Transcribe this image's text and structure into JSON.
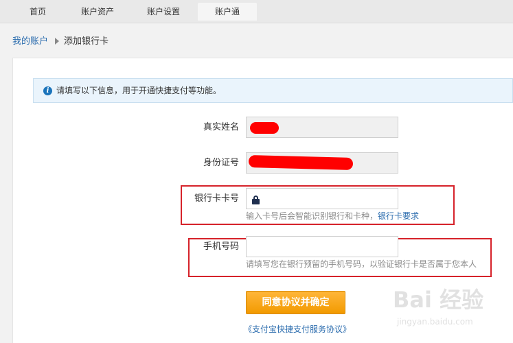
{
  "nav": {
    "tabs": [
      {
        "label": "首页"
      },
      {
        "label": "账户资产"
      },
      {
        "label": "账户设置"
      },
      {
        "label": "账户通"
      }
    ]
  },
  "breadcrumb": {
    "parent": "我的账户",
    "current": "添加银行卡"
  },
  "notice": {
    "icon": "info-icon",
    "text": "请填写以下信息，用于开通快捷支付等功能。"
  },
  "form": {
    "name_label": "真实姓名",
    "id_label": "身份证号",
    "card_label": "银行卡卡号",
    "card_hint": "输入卡号后会智能识别银行和卡种，",
    "card_requirements_link": "银行卡要求",
    "phone_label": "手机号码",
    "phone_hint": "请填写您在银行预留的手机号码，以验证银行卡是否属于您本人"
  },
  "actions": {
    "agree_button": "同意协议并确定",
    "agreement_link": "《支付宝快捷支付服务协议》"
  },
  "watermark": {
    "text": "Bai 经验",
    "url": "jingyan.baidu.com"
  },
  "colors": {
    "link": "#2b6cae",
    "button": "#f29a00",
    "annotation": "#d6222a",
    "redaction": "#ff0000"
  }
}
